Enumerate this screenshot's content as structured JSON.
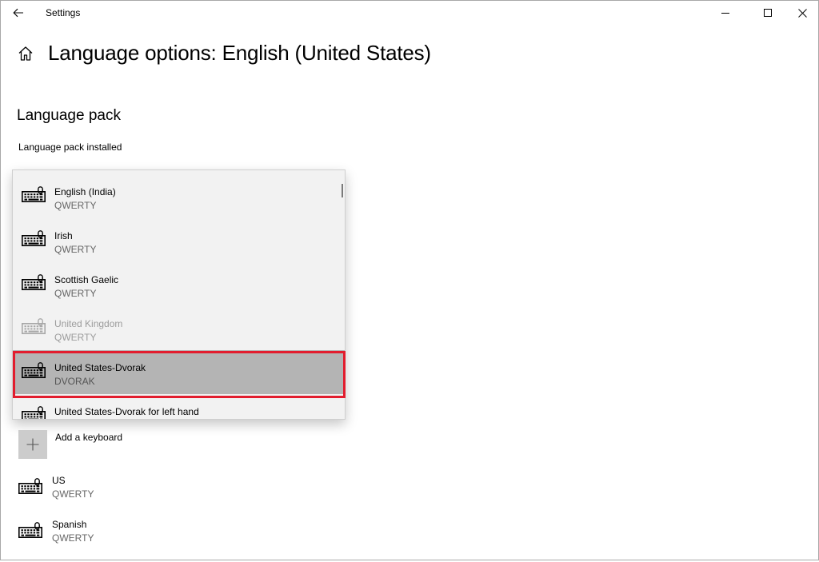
{
  "window": {
    "title": "Settings"
  },
  "page": {
    "title": "Language options: English (United States)",
    "section_title": "Language pack",
    "pack_status": "Language pack installed"
  },
  "flyout": {
    "items": [
      {
        "name": "English (India)",
        "layout": "QWERTY",
        "state": "normal"
      },
      {
        "name": "Irish",
        "layout": "QWERTY",
        "state": "normal"
      },
      {
        "name": "Scottish Gaelic",
        "layout": "QWERTY",
        "state": "normal"
      },
      {
        "name": "United Kingdom",
        "layout": "QWERTY",
        "state": "disabled"
      },
      {
        "name": "United States-Dvorak",
        "layout": "DVORAK",
        "state": "selected"
      },
      {
        "name": "United States-Dvorak for left hand",
        "layout": "",
        "state": "normal"
      }
    ]
  },
  "keyboards": {
    "add_label": "Add a keyboard",
    "installed": [
      {
        "name": "US",
        "layout": "QWERTY"
      },
      {
        "name": "Spanish",
        "layout": "QWERTY"
      }
    ]
  },
  "icons": {
    "back": "back-arrow-icon",
    "home": "home-icon",
    "keyboard": "keyboard-icon",
    "add": "plus-icon"
  },
  "colors": {
    "selection_outline": "#e21d2e",
    "selected_bg": "#b4b4b4",
    "flyout_bg": "#f2f2f2"
  }
}
